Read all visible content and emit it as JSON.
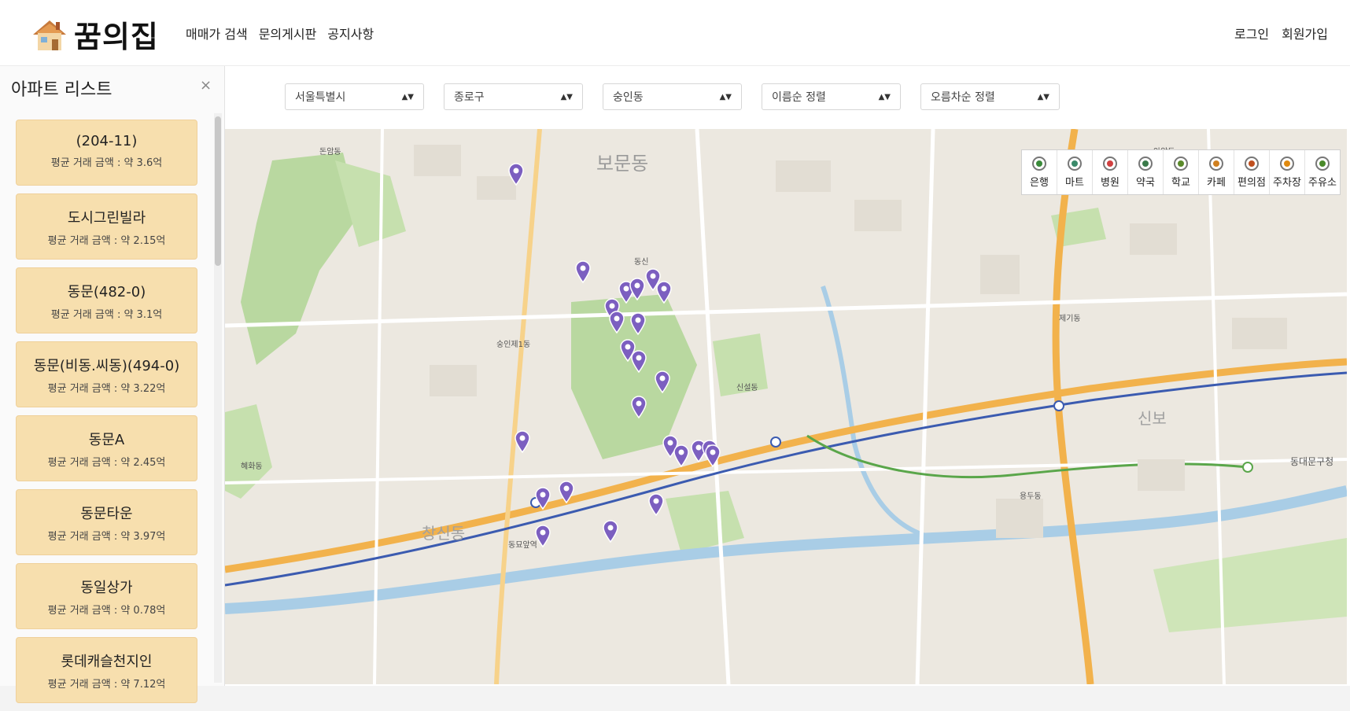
{
  "header": {
    "logo_text": "꿈의집",
    "nav": [
      "매매가 검색",
      "문의게시판",
      "공지사항"
    ],
    "auth": [
      "로그인",
      "회원가입"
    ]
  },
  "sidebar": {
    "title": "아파트 리스트",
    "close": "×",
    "items": [
      {
        "name": "(204-11)",
        "price": "평균 거래 금액 : 약 3.6억"
      },
      {
        "name": "도시그린빌라",
        "price": "평균 거래 금액 : 약 2.15억"
      },
      {
        "name": "동문(482-0)",
        "price": "평균 거래 금액 : 약 3.1억"
      },
      {
        "name": "동문(비동.씨동)(494-0)",
        "price": "평균 거래 금액 : 약 3.22억"
      },
      {
        "name": "동문A",
        "price": "평균 거래 금액 : 약 2.45억"
      },
      {
        "name": "동문타운",
        "price": "평균 거래 금액 : 약 3.97억"
      },
      {
        "name": "동일상가",
        "price": "평균 거래 금액 : 약 0.78억"
      },
      {
        "name": "롯데캐슬천지인",
        "price": "평균 거래 금액 : 약 7.12억"
      }
    ]
  },
  "filters": [
    {
      "label": "서울특별시"
    },
    {
      "label": "종로구"
    },
    {
      "label": "숭인동"
    },
    {
      "label": "이름순 정렬"
    },
    {
      "label": "오름차순 정렬"
    }
  ],
  "categories": [
    {
      "label": "은행",
      "color": "#3a8a3a"
    },
    {
      "label": "마트",
      "color": "#3a8a6a"
    },
    {
      "label": "병원",
      "color": "#d04040"
    },
    {
      "label": "약국",
      "color": "#3a7a4a"
    },
    {
      "label": "학교",
      "color": "#5a8a2a"
    },
    {
      "label": "카페",
      "color": "#d08020"
    },
    {
      "label": "편의점",
      "color": "#c05020"
    },
    {
      "label": "주차장",
      "color": "#e08a10"
    },
    {
      "label": "주유소",
      "color": "#4a8a2a"
    }
  ],
  "map": {
    "labels": {
      "bomun": "보문동",
      "sinseol": "신설동",
      "sungin1": "숭인제1동",
      "dongmyo": "동묘앞역",
      "changsin": "창신동",
      "dongdaemun_gu": "동대문구청",
      "yongdu": "용두동",
      "sinbo": "신보",
      "jegi": "제기동",
      "anam": "안암동",
      "donam": "돈암동",
      "dongsin": "동신",
      "hyehwa": "혜화동"
    },
    "colors": {
      "marker": "#7c5fc0",
      "park": "#b9d8a0",
      "water": "#a9cde6",
      "road_major": "#f2b24c",
      "subway": "#3b5bb0"
    }
  }
}
